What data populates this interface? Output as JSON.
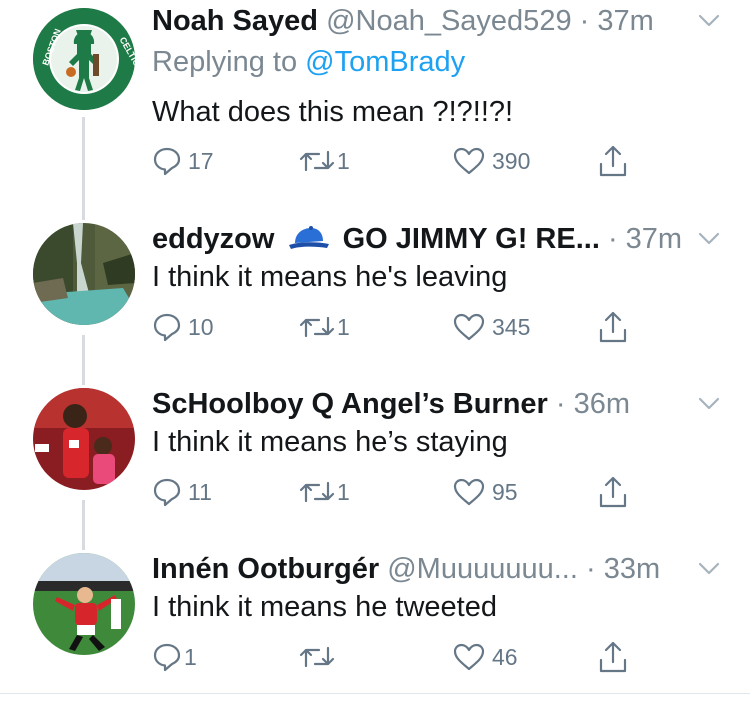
{
  "tweets": [
    {
      "name": "Noah Sayed",
      "handle": "@Noah_Sayed529",
      "time": "37m",
      "reply_prefix": "Replying to",
      "reply_mention": "@TomBrady",
      "text": "What does this mean ?!?!!?!",
      "replies": "17",
      "retweets": "1",
      "likes": "390",
      "avatar": "celtics-logo"
    },
    {
      "name": "eddyzow",
      "name_suffix": "GO JIMMY G! RE...",
      "handle": "",
      "time": "37m",
      "text": "I think it means he's leaving",
      "replies": "10",
      "retweets": "1",
      "likes": "345",
      "avatar": "waterfall-photo"
    },
    {
      "name": "ScHoolboy Q Angel’s Burner",
      "handle": "",
      "time": "36m",
      "text": "I think it means he’s staying",
      "replies": "11",
      "retweets": "1",
      "likes": "95",
      "avatar": "person-photo"
    },
    {
      "name": "Innén Ootburgér",
      "handle": "@Muuuuuuu...",
      "time": "33m",
      "text": "I think it means he tweeted",
      "replies": "1",
      "retweets": "",
      "likes": "46",
      "avatar": "soccer-photo"
    }
  ],
  "separator": "·",
  "icons": {
    "reply": "reply-icon",
    "retweet": "retweet-icon",
    "like": "heart-icon",
    "share": "share-icon",
    "more": "chevron-down-icon",
    "cap": "blue-cap-emoji"
  },
  "colors": {
    "link": "#1da1f2",
    "muted": "#7b8892",
    "icon": "#657786",
    "thread_line": "#d7dbdf"
  }
}
